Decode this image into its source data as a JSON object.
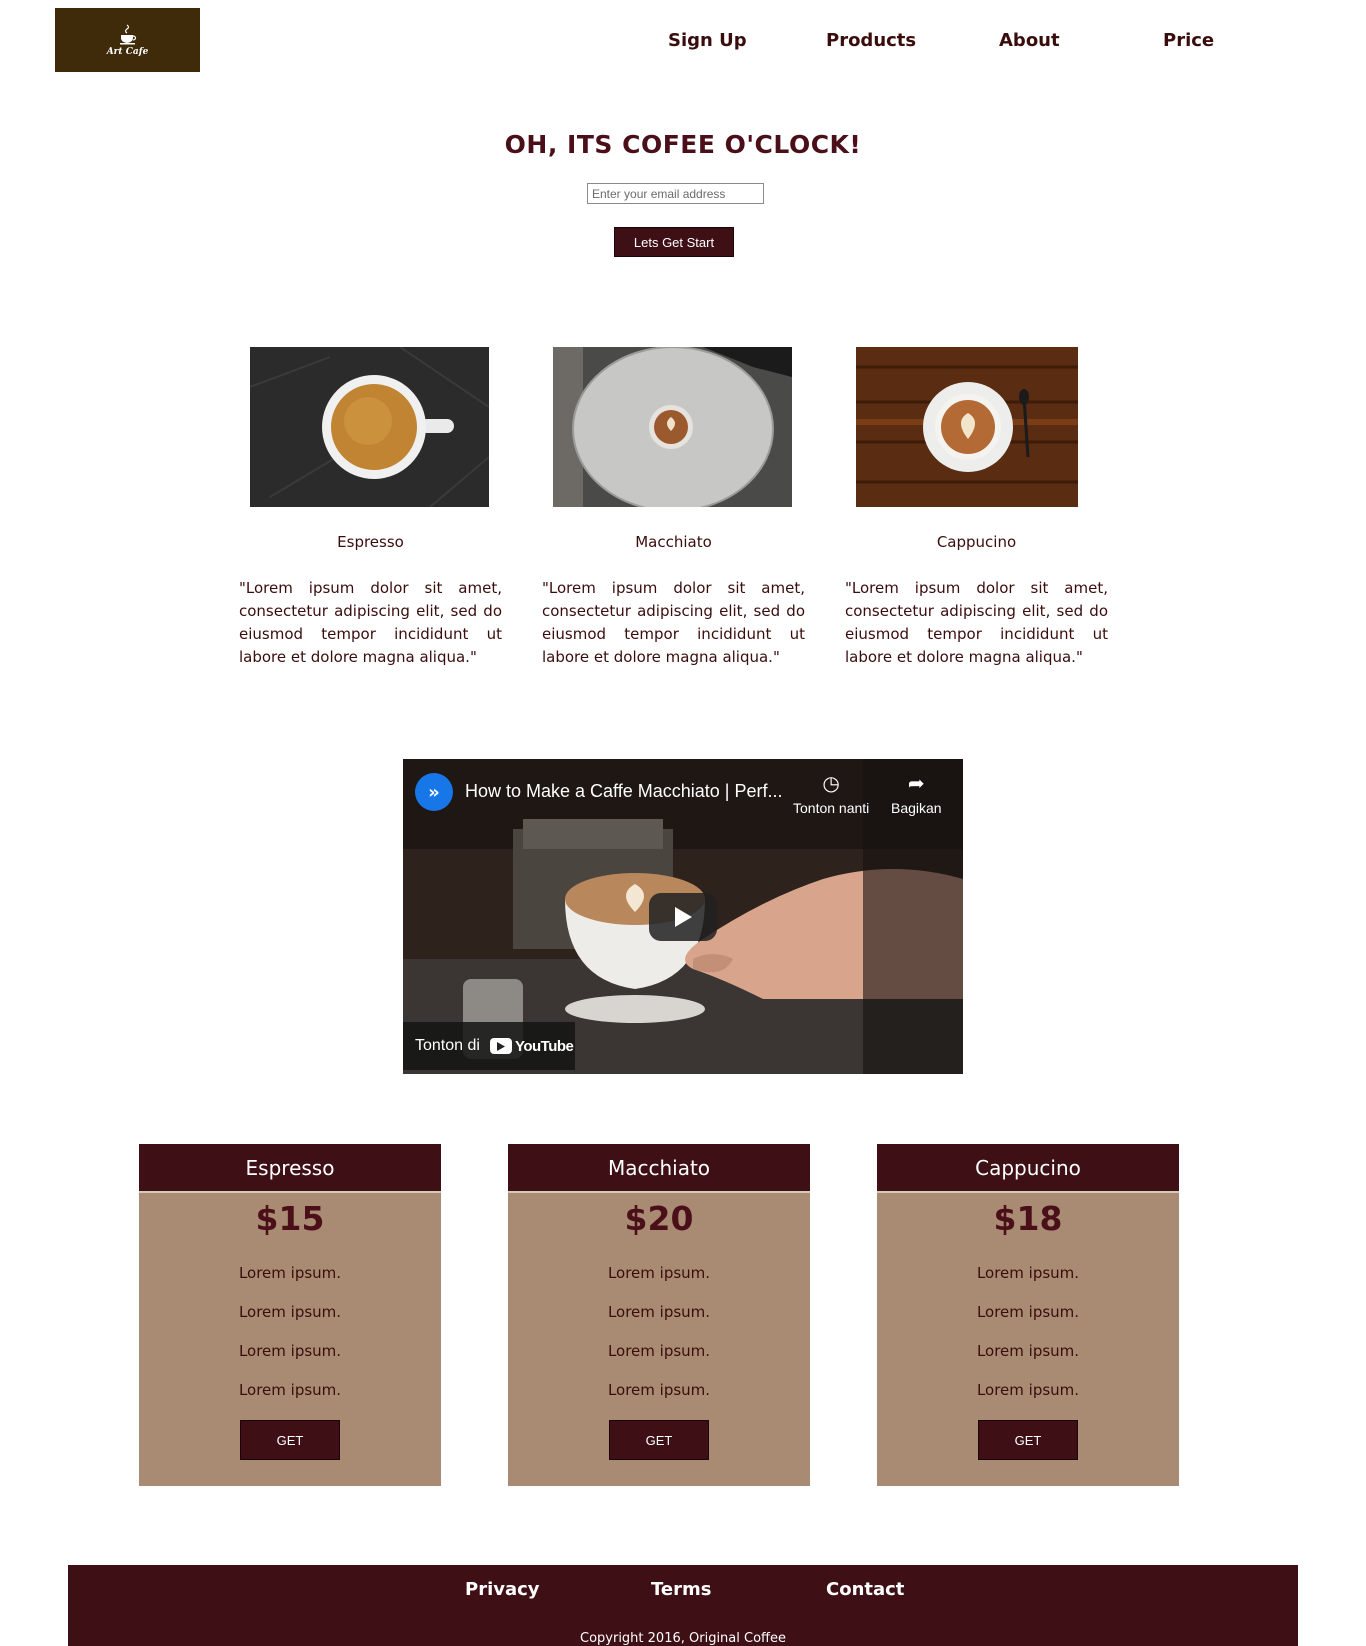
{
  "brand": {
    "logo_text": "Art Cafe",
    "logo_icon": "coffee-cup-icon"
  },
  "nav": {
    "items": [
      "Sign Up",
      "Products",
      "About",
      "Price"
    ]
  },
  "hero": {
    "title": "OH, ITS COFEE O'CLOCK!",
    "email_placeholder": "Enter your email address",
    "cta_label": "Lets Get Start"
  },
  "products": [
    {
      "name": "Espresso",
      "description": "\"Lorem ipsum dolor sit amet, consectetur adipiscing elit, sed do eiusmod tempor incididunt ut labore et dolore magna aliqua.\""
    },
    {
      "name": "Macchiato",
      "description": "\"Lorem ipsum dolor sit amet, consectetur adipiscing elit, sed do eiusmod tempor incididunt ut labore et dolore magna aliqua.\""
    },
    {
      "name": "Cappucino",
      "description": "\"Lorem ipsum dolor sit amet, consectetur adipiscing elit, sed do eiusmod tempor incididunt ut labore et dolore magna aliqua.\""
    }
  ],
  "video": {
    "title": "How to Make a Caffe Macchiato | Perf...",
    "watch_later": "Tonton nanti",
    "share": "Bagikan",
    "watch_on": "Tonton di",
    "platform": "YouTube"
  },
  "pricing": [
    {
      "name": "Espresso",
      "price": "$15",
      "features": [
        "Lorem ipsum.",
        "Lorem ipsum.",
        "Lorem ipsum.",
        "Lorem ipsum."
      ],
      "button": "GET"
    },
    {
      "name": "Macchiato",
      "price": "$20",
      "features": [
        "Lorem ipsum.",
        "Lorem ipsum.",
        "Lorem ipsum.",
        "Lorem ipsum."
      ],
      "button": "GET"
    },
    {
      "name": "Cappucino",
      "price": "$18",
      "features": [
        "Lorem ipsum.",
        "Lorem ipsum.",
        "Lorem ipsum.",
        "Lorem ipsum."
      ],
      "button": "GET"
    }
  ],
  "footer": {
    "links": [
      "Privacy",
      "Terms",
      "Contact"
    ],
    "copyright": "Copyright 2016, Original Coffee"
  },
  "colors": {
    "brand_dark": "#3e1016",
    "logo_bg": "#3f2a0a",
    "card_bg": "#a88b72"
  }
}
